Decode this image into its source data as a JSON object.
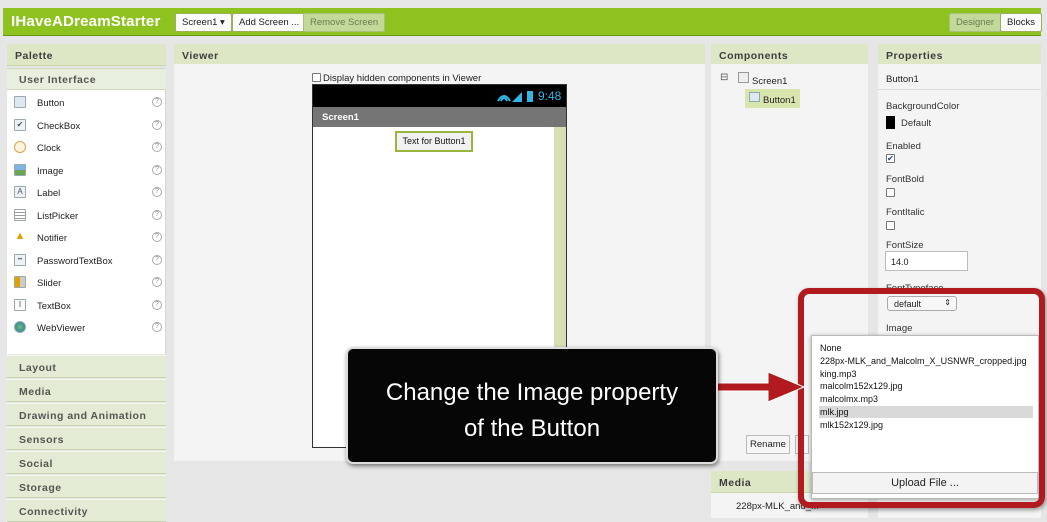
{
  "app": {
    "title": "IHaveADreamStarter"
  },
  "toolbar": {
    "screen_dropdown": "Screen1 ▾",
    "add_screen": "Add Screen ...",
    "remove_screen": "Remove Screen",
    "designer": "Designer",
    "blocks": "Blocks"
  },
  "palette": {
    "header": "Palette",
    "section": "User Interface",
    "items": [
      {
        "label": "Button",
        "icon": "button-icon"
      },
      {
        "label": "CheckBox",
        "icon": "checkbox-icon"
      },
      {
        "label": "Clock",
        "icon": "clock-icon"
      },
      {
        "label": "Image",
        "icon": "image-icon"
      },
      {
        "label": "Label",
        "icon": "label-icon"
      },
      {
        "label": "ListPicker",
        "icon": "listpicker-icon"
      },
      {
        "label": "Notifier",
        "icon": "notifier-icon"
      },
      {
        "label": "PasswordTextBox",
        "icon": "password-icon"
      },
      {
        "label": "Slider",
        "icon": "slider-icon"
      },
      {
        "label": "TextBox",
        "icon": "textbox-icon"
      },
      {
        "label": "WebViewer",
        "icon": "webviewer-icon"
      }
    ],
    "help_glyph": "?",
    "categories": [
      "Layout",
      "Media",
      "Drawing and Animation",
      "Sensors",
      "Social",
      "Storage",
      "Connectivity"
    ]
  },
  "viewer": {
    "header": "Viewer",
    "hidden_checkbox_label": "Display hidden components in Viewer",
    "time": "9:48",
    "screen_title": "Screen1",
    "button_text": "Text for Button1"
  },
  "components": {
    "header": "Components",
    "collapse_glyph": "⊟",
    "root": "Screen1",
    "child": "Button1",
    "rename": "Rename"
  },
  "media": {
    "header": "Media",
    "first_item": "228px-MLK_and_M"
  },
  "properties": {
    "header": "Properties",
    "component": "Button1",
    "background_color_label": "BackgroundColor",
    "background_color_value": "Default",
    "enabled_label": "Enabled",
    "fontbold_label": "FontBold",
    "fontitalic_label": "FontItalic",
    "fontsize_label": "FontSize",
    "fontsize_value": "14.0",
    "fonttypeface_label": "FontTypeface",
    "fonttypeface_value": "default",
    "image_label": "Image"
  },
  "image_picker": {
    "options": [
      "None",
      "228px-MLK_and_Malcolm_X_USNWR_cropped.jpg",
      "king.mp3",
      "malcolm152x129.jpg",
      "malcolmx.mp3",
      "mlk.jpg",
      "mlk152x129.jpg"
    ],
    "selected": "mlk.jpg",
    "upload": "Upload File ..."
  },
  "callout": {
    "line1": "Change the Image property",
    "line2": "of the Button"
  },
  "colors": {
    "brand": "#8ec21f",
    "callout_border": "#b11b1f",
    "callout_bg": "#060606"
  }
}
